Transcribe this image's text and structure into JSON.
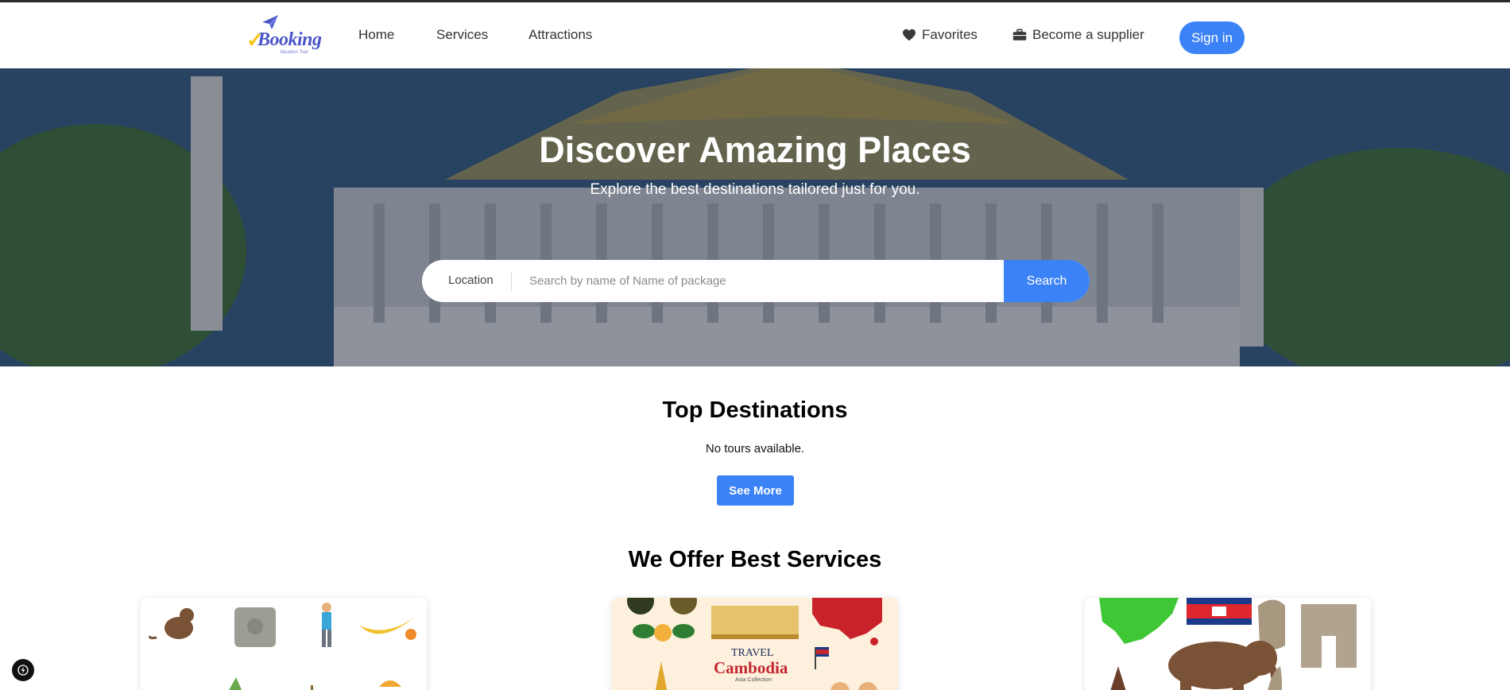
{
  "header": {
    "logo": {
      "text": "Booking",
      "subtext": "Vacation Tour"
    },
    "nav": [
      {
        "label": "Home"
      },
      {
        "label": "Services"
      },
      {
        "label": "Attractions"
      }
    ],
    "favorites_label": "Favorites",
    "supplier_label": "Become a supplier",
    "signin_label": "Sign in",
    "icons": {
      "favorites": "heart-icon",
      "supplier": "briefcase-icon"
    }
  },
  "hero": {
    "title": "Discover Amazing Places",
    "subtitle": "Explore the best destinations tailored just for you.",
    "search": {
      "location_label": "Location",
      "placeholder": "Search by name of Name of package",
      "button_label": "Search"
    }
  },
  "top_destinations": {
    "title": "Top Destinations",
    "empty_message": "No tours available.",
    "see_more_label": "See More"
  },
  "services": {
    "title": "We Offer Best Services",
    "cards": [
      {
        "image": "cambodia-icons-illustration"
      },
      {
        "image": "travel-cambodia-poster",
        "poster_line1": "TRAVEL",
        "poster_line2": "Cambodia",
        "poster_line3": "Asia Collection"
      },
      {
        "image": "cambodia-map-flag-elephant-illustration"
      }
    ]
  },
  "colors": {
    "accent": "#3b82f6",
    "topbar": "#2b2b2b",
    "logo_primary": "#4a56c7",
    "logo_check": "#f5c518"
  }
}
